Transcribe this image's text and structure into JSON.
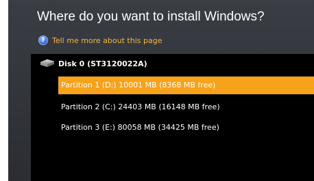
{
  "dialog": {
    "title": "Where do you want to install Windows?",
    "help_icon": "help-question-icon",
    "help_link": "Tell me more about this page"
  },
  "disk": {
    "icon": "hard-drive-icon",
    "label": "Disk 0 (ST3120022A)"
  },
  "partitions": [
    {
      "label": "Partition 1 (D:) 10001 MB (8368 MB free)",
      "selected": true
    },
    {
      "label": "Partition 2 (C:) 24403 MB (16148 MB free)",
      "selected": false
    },
    {
      "label": "Partition 3 (E:) 80058 MB (34425 MB free)",
      "selected": false
    }
  ],
  "colors": {
    "selection": "#f7a21b",
    "link": "#f5b63c",
    "list_background": "#000000",
    "window_background": "#34373d"
  }
}
